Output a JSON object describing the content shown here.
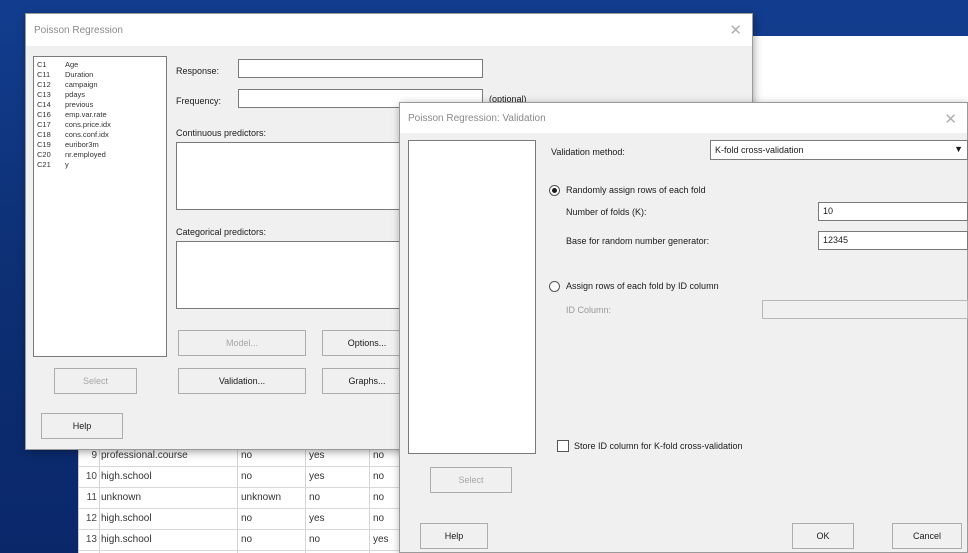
{
  "worksheet": {
    "rows": [
      {
        "n": "9",
        "c1": "professional.course",
        "c2": "no",
        "c3": "yes",
        "c4": "no"
      },
      {
        "n": "10",
        "c1": "high.school",
        "c2": "no",
        "c3": "yes",
        "c4": "no"
      },
      {
        "n": "11",
        "c1": "unknown",
        "c2": "unknown",
        "c3": "no",
        "c4": "no"
      },
      {
        "n": "12",
        "c1": "high.school",
        "c2": "no",
        "c3": "yes",
        "c4": "no"
      },
      {
        "n": "13",
        "c1": "high.school",
        "c2": "no",
        "c3": "no",
        "c4": "yes"
      }
    ]
  },
  "main_dialog": {
    "title": "Poisson Regression",
    "close": "✕",
    "columns": [
      {
        "id": "C1",
        "name": "Age"
      },
      {
        "id": "C11",
        "name": "Duration"
      },
      {
        "id": "C12",
        "name": "campaign"
      },
      {
        "id": "C13",
        "name": "pdays"
      },
      {
        "id": "C14",
        "name": "previous"
      },
      {
        "id": "C16",
        "name": "emp.var.rate"
      },
      {
        "id": "C17",
        "name": "cons.price.idx"
      },
      {
        "id": "C18",
        "name": "cons.conf.idx"
      },
      {
        "id": "C19",
        "name": "euribor3m"
      },
      {
        "id": "C20",
        "name": "nr.employed"
      },
      {
        "id": "C21",
        "name": "y"
      }
    ],
    "response_label": "Response:",
    "frequency_label": "Frequency:",
    "optional_label": "(optional)",
    "continuous_label": "Continuous predictors:",
    "categorical_label": "Categorical predictors:",
    "select_button": "Select",
    "model_button": "Model...",
    "options_button": "Options...",
    "validation_button": "Validation...",
    "graphs_button": "Graphs...",
    "help_button": "Help"
  },
  "validation_dialog": {
    "title": "Poisson Regression: Validation",
    "close": "✕",
    "method_label": "Validation method:",
    "method_value": "K-fold cross-validation",
    "dropdown_arrow": "▼",
    "radio_random_label": "Randomly assign rows of each fold",
    "folds_label": "Number of folds (K):",
    "folds_value": "10",
    "seed_label": "Base for random number generator:",
    "seed_value": "12345",
    "radio_id_label": "Assign rows of each fold by ID column",
    "id_column_label": "ID Column:",
    "store_label": "Store ID column for K-fold cross-validation",
    "select_button": "Select",
    "help_button": "Help",
    "ok_button": "OK",
    "cancel_button": "Cancel"
  }
}
